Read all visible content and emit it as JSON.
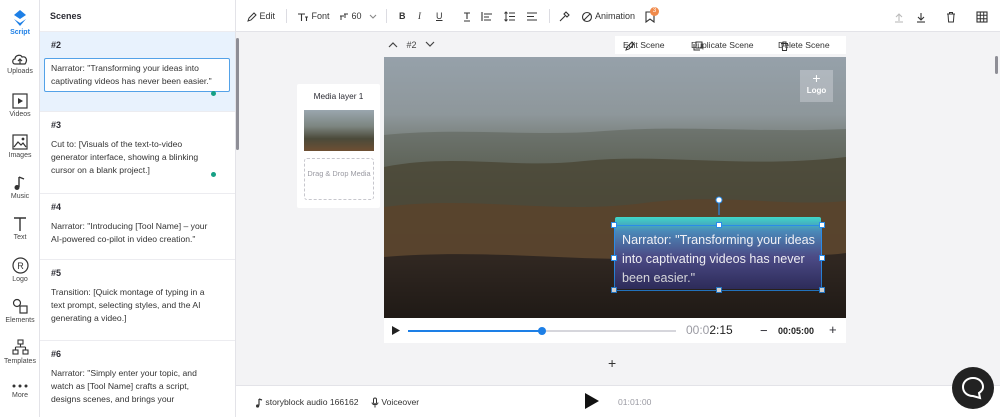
{
  "rail": {
    "items": [
      {
        "label": "Script",
        "icon": "script-icon",
        "active": true
      },
      {
        "label": "Uploads",
        "icon": "upload-icon"
      },
      {
        "label": "Videos",
        "icon": "video-icon"
      },
      {
        "label": "Images",
        "icon": "image-icon"
      },
      {
        "label": "Music",
        "icon": "music-icon"
      },
      {
        "label": "Text",
        "icon": "text-icon"
      },
      {
        "label": "Logo",
        "icon": "logo-icon"
      },
      {
        "label": "Elements",
        "icon": "elements-icon"
      },
      {
        "label": "Templates",
        "icon": "templates-icon"
      },
      {
        "label": "More",
        "icon": "more-icon"
      }
    ]
  },
  "scenes": {
    "title": "Scenes",
    "items": [
      {
        "num": "#2",
        "text": "Narrator: \"Transforming your ideas into captivating videos has never been easier.\""
      },
      {
        "num": "#3",
        "text": "Cut to: [Visuals of the text-to-video generator interface, showing a blinking cursor on a blank project.]"
      },
      {
        "num": "#4",
        "text": "Narrator: \"Introducing [Tool Name] – your AI-powered co-pilot in video creation.\""
      },
      {
        "num": "#5",
        "text": "Transition: [Quick montage of typing in a text prompt, selecting styles, and the AI generating a video.]"
      },
      {
        "num": "#6",
        "text": "Narrator: \"Simply enter your topic, and watch as [Tool Name] crafts a script, designs scenes, and brings your"
      }
    ]
  },
  "toolbar": {
    "edit": "Edit",
    "font": "Font",
    "font_size": "60",
    "bold": "B",
    "italic": "I",
    "underline": "U",
    "animation": "Animation",
    "badge_count": "3"
  },
  "scene_nav": {
    "label": "#2"
  },
  "scene_actions": {
    "edit": "Edit Scene",
    "duplicate": "Duplicate Scene",
    "delete": "Delete Scene"
  },
  "media_layer": {
    "title": "Media layer 1",
    "dropzone": "Drag & Drop Media"
  },
  "preview": {
    "logo_label": "Logo",
    "caption": "Narrator: \"Transforming your ideas into captivating videos has never been easier.\""
  },
  "player": {
    "current_time_dim": "00:0",
    "current_time": "2:15",
    "duration": "00:05:00",
    "progress": 0.5
  },
  "bottombar": {
    "audio": "storyblock audio 166162",
    "voiceover": "Voiceover",
    "timeline_time": "01:01:00"
  },
  "colors": {
    "accent": "#1d7fe6",
    "dot": "#16a085",
    "badge": "#f08a4b"
  }
}
